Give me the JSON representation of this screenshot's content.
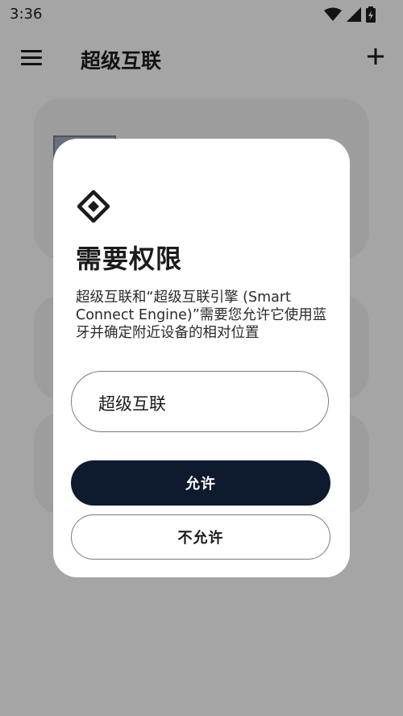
{
  "status_bar": {
    "time": "3:36",
    "icons": [
      "wifi-icon",
      "signal-icon",
      "battery-icon"
    ]
  },
  "app_bar": {
    "title": "超级互联",
    "menu_icon": "menu-icon",
    "add_icon": "add-icon"
  },
  "dialog": {
    "icon": "permission-diamond-icon",
    "title": "需要权限",
    "message": "超级互联和“超级互联引擎 (Smart Connect Engine)”需要您允许它使用蓝牙并确定附近设备的相对位置",
    "app_name": "超级互联",
    "allow_label": "允许",
    "deny_label": "不允许"
  },
  "colors": {
    "primary_button": "#0e1a2e",
    "scrim": "rgba(0,0,0,0.32)",
    "dialog_bg": "#ffffff"
  }
}
